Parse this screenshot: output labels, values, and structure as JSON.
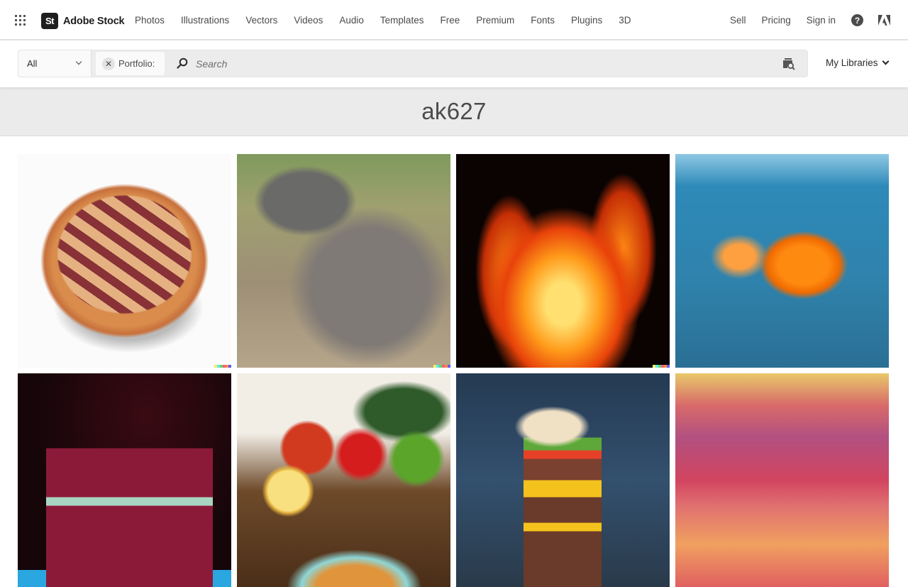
{
  "brand": {
    "badge": "St",
    "name": "Adobe Stock"
  },
  "nav": {
    "links": [
      "Photos",
      "Illustrations",
      "Vectors",
      "Videos",
      "Audio",
      "Templates",
      "Free",
      "Premium",
      "Fonts",
      "Plugins",
      "3D"
    ],
    "right": {
      "sell": "Sell",
      "pricing": "Pricing",
      "sign_in": "Sign in",
      "help_glyph": "?"
    }
  },
  "search": {
    "filter_value": "All",
    "chip_label": "Portfolio:",
    "chip_remove_glyph": "✕",
    "placeholder": "Search",
    "value": "",
    "my_libraries": "My Libraries"
  },
  "portfolio": {
    "title": "ak627"
  },
  "results": [
    {
      "subject": "Lattice cherry pie",
      "ai_badge": true,
      "style": "pie"
    },
    {
      "subject": "Kangaroo",
      "ai_badge": true,
      "style": "kangaroo"
    },
    {
      "subject": "Fire flames",
      "ai_badge": true,
      "style": "fire"
    },
    {
      "subject": "Goldfish underwater",
      "ai_badge": false,
      "style": "fish"
    },
    {
      "subject": "Red velvet cake slice",
      "ai_badge": false,
      "style": "cake"
    },
    {
      "subject": "Vegetables and fried fish",
      "ai_badge": false,
      "style": "veg"
    },
    {
      "subject": "Stacked cheeseburger",
      "ai_badge": false,
      "style": "burger"
    },
    {
      "subject": "Watercolor sunset sky",
      "ai_badge": false,
      "style": "sunset"
    }
  ]
}
